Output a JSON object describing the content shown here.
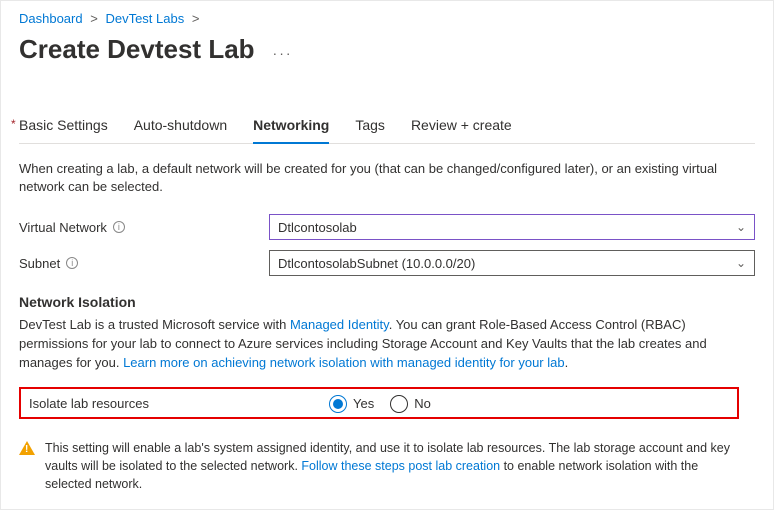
{
  "breadcrumb": {
    "items": [
      "Dashboard",
      "DevTest Labs"
    ]
  },
  "page_title": "Create Devtest Lab",
  "tabs": {
    "items": [
      {
        "label": "Basic Settings",
        "required": true
      },
      {
        "label": "Auto-shutdown"
      },
      {
        "label": "Networking",
        "active": true
      },
      {
        "label": "Tags"
      },
      {
        "label": "Review + create"
      }
    ]
  },
  "networking": {
    "description": "When creating a lab, a default network will be created for you (that can be changed/configured later), or an existing virtual network can be selected.",
    "vnet_label": "Virtual Network",
    "vnet_value": "Dtlcontosolab",
    "subnet_label": "Subnet",
    "subnet_value": "DtlcontosolabSubnet (10.0.0.0/20)"
  },
  "isolation": {
    "heading": "Network Isolation",
    "intro_a": "DevTest Lab is a trusted Microsoft service with ",
    "managed_identity_link": "Managed Identity",
    "intro_b": ". You can grant Role-Based Access Control (RBAC) permissions for your lab to connect to Azure services including Storage Account and Key Vaults that the lab creates and manages for you. ",
    "learn_more_link": "Learn more on achieving network isolation with managed identity for your lab",
    "option_label": "Isolate lab resources",
    "yes_label": "Yes",
    "no_label": "No",
    "selected": "Yes"
  },
  "warning": {
    "text_a": "This setting will enable a lab's system assigned identity, and use it to isolate lab resources. The lab storage account and key vaults will be isolated to the selected network. ",
    "link": "Follow these steps post lab creation",
    "text_b": " to enable network isolation with the selected network."
  }
}
